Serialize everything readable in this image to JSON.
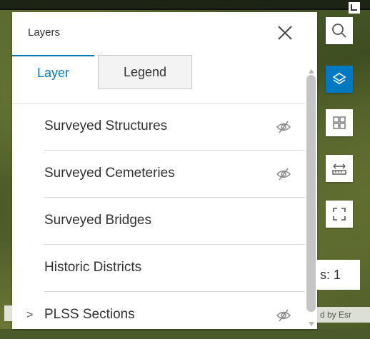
{
  "panel": {
    "title": "Layers",
    "tabs": [
      {
        "label": "Layer",
        "active": true
      },
      {
        "label": "Legend",
        "active": false
      }
    ],
    "layers": [
      {
        "label": "Surveyed Structures",
        "visibility_icon": "eye-off-icon"
      },
      {
        "label": "Surveyed Cemeteries",
        "visibility_icon": "eye-off-icon"
      },
      {
        "label": "Surveyed Bridges"
      },
      {
        "label": "Historic Districts"
      },
      {
        "label": "PLSS Sections",
        "visibility_icon": "eye-off-icon",
        "expandable": true,
        "chevron": ">"
      }
    ]
  },
  "toolbar": {
    "buttons": [
      {
        "icon": "search-icon"
      },
      {
        "icon": "layers-icon",
        "active": true
      },
      {
        "icon": "basemap-gallery-icon"
      },
      {
        "icon": "measure-icon"
      },
      {
        "icon": "fullscreen-icon"
      }
    ]
  },
  "map": {
    "scale_text": "s: 1",
    "attribution": "d by Esr"
  },
  "colors": {
    "accent": "#0079c1",
    "text": "#323232"
  }
}
